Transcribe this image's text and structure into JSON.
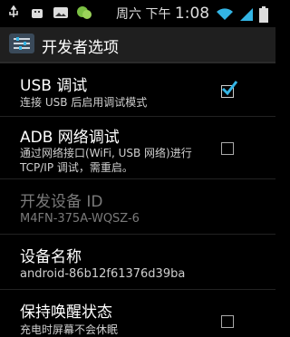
{
  "status": {
    "time_prefix": "周六 下午 ",
    "time": "1:08",
    "icons": [
      "usb-icon",
      "android-debug-icon",
      "image-icon",
      "wechat-icon",
      "wifi-icon",
      "signal-icon",
      "battery-icon"
    ]
  },
  "header": {
    "title": "开发者选项",
    "icon": "settings-sliders-icon"
  },
  "prefs": [
    {
      "title": "USB 调试",
      "summary": "连接 USB 后启用调试模式",
      "checked": true
    },
    {
      "title": "ADB 网络调试",
      "summary": "通过网络接口(WiFi, USB 网络)进行\nTCP/IP 调试，需重启。",
      "checked": false
    },
    {
      "title": "开发设备 ID",
      "summary": "M4FN-375A-WQSZ-6",
      "disabled": true
    },
    {
      "title": "设备名称",
      "summary": "android-86b12f61376d39ba"
    },
    {
      "title": "保持唤醒状态",
      "summary": "充电时屏幕不会休眠",
      "checked": false
    }
  ]
}
